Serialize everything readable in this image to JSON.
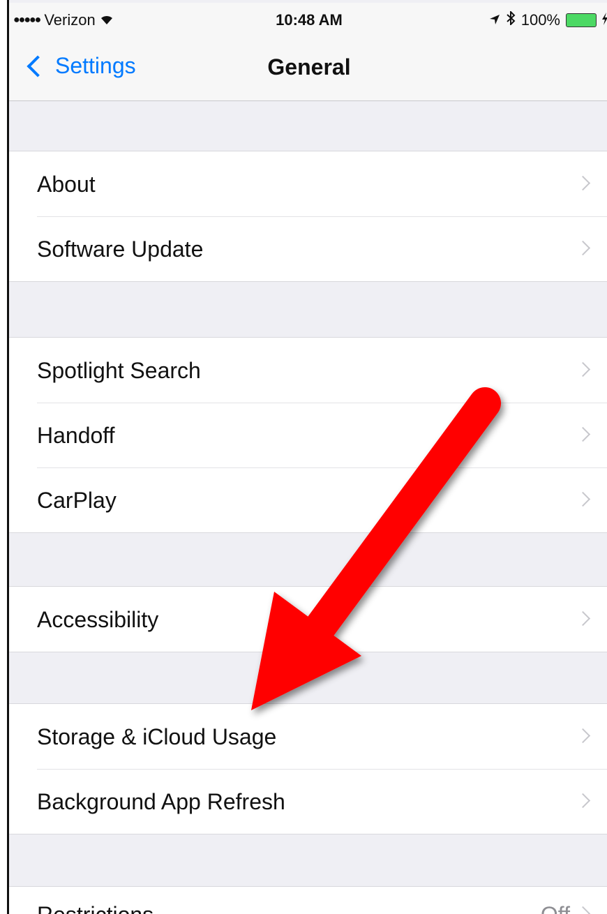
{
  "status_bar": {
    "signal": "●●●●●",
    "carrier": "Verizon",
    "wifi": "wifi-icon",
    "time": "10:48 AM",
    "battery": "100%",
    "icons": [
      "location-icon",
      "bluetooth-icon",
      "battery-icon",
      "charging-icon"
    ]
  },
  "nav": {
    "back_label": "Settings",
    "title": "General"
  },
  "groups": [
    {
      "rows": [
        {
          "label": "About"
        },
        {
          "label": "Software Update"
        }
      ]
    },
    {
      "rows": [
        {
          "label": "Spotlight Search"
        },
        {
          "label": "Handoff"
        },
        {
          "label": "CarPlay"
        }
      ]
    },
    {
      "rows": [
        {
          "label": "Accessibility"
        }
      ]
    },
    {
      "rows": [
        {
          "label": "Storage & iCloud Usage"
        },
        {
          "label": "Background App Refresh"
        }
      ]
    },
    {
      "rows": [
        {
          "label": "Restrictions",
          "value": "Off"
        }
      ]
    }
  ],
  "annotation": {
    "arrow_color": "#ff0000"
  }
}
